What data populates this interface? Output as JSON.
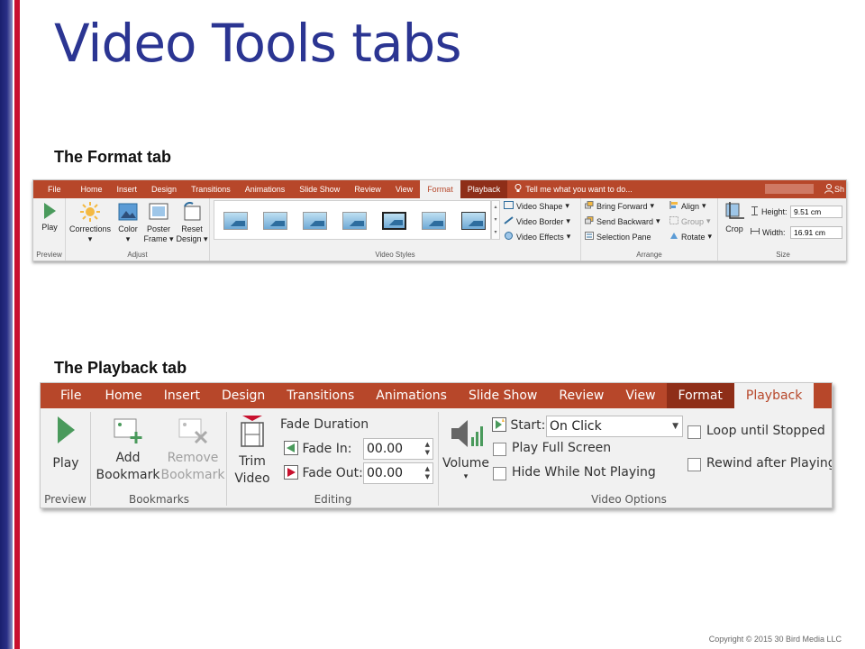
{
  "slide": {
    "title": "Video Tools tabs",
    "format_label": "The Format tab",
    "playback_label": "The Playback tab",
    "copyright": "Copyright © 2015 30 Bird Media LLC"
  },
  "format_ribbon": {
    "tabs": [
      "File",
      "Home",
      "Insert",
      "Design",
      "Transitions",
      "Animations",
      "Slide Show",
      "Review",
      "View",
      "Format",
      "Playback"
    ],
    "active_tab": "Format",
    "tell_me": "Tell me what you want to do...",
    "share": "Sh",
    "groups": {
      "preview": "Preview",
      "adjust": "Adjust",
      "video_styles": "Video Styles",
      "arrange": "Arrange",
      "size": "Size"
    },
    "buttons": {
      "play": "Play",
      "corrections": "Corrections",
      "color": "Color",
      "poster_frame_1": "Poster",
      "poster_frame_2": "Frame",
      "reset_design_1": "Reset",
      "reset_design_2": "Design",
      "video_shape": "Video Shape",
      "video_border": "Video Border",
      "video_effects": "Video Effects",
      "bring_forward": "Bring Forward",
      "send_backward": "Send Backward",
      "selection_pane": "Selection Pane",
      "align": "Align",
      "group": "Group",
      "rotate": "Rotate",
      "crop": "Crop",
      "height_label": "Height:",
      "width_label": "Width:"
    },
    "height_value": "9.51 cm",
    "width_value": "16.91 cm"
  },
  "playback_ribbon": {
    "tabs": [
      "File",
      "Home",
      "Insert",
      "Design",
      "Transitions",
      "Animations",
      "Slide Show",
      "Review",
      "View",
      "Format",
      "Playback"
    ],
    "active_tab": "Playback",
    "groups": {
      "preview": "Preview",
      "bookmarks": "Bookmarks",
      "editing": "Editing",
      "video_options": "Video Options"
    },
    "buttons": {
      "play": "Play",
      "add_bookmark_1": "Add",
      "add_bookmark_2": "Bookmark",
      "remove_bookmark_1": "Remove",
      "remove_bookmark_2": "Bookmark",
      "trim_video_1": "Trim",
      "trim_video_2": "Video",
      "volume": "Volume"
    },
    "fade_duration": "Fade Duration",
    "fade_in_label": "Fade In:",
    "fade_in_value": "00.00",
    "fade_out_label": "Fade Out:",
    "fade_out_value": "00.00",
    "start_label": "Start:",
    "start_value": "On Click",
    "play_full_screen": "Play Full Screen",
    "hide_while_not_playing": "Hide While Not Playing",
    "loop_until_stopped": "Loop until Stopped",
    "rewind_after_playing": "Rewind after Playing",
    "checkboxes": {
      "play_full_screen": false,
      "hide_while_not_playing": false,
      "loop_until_stopped": false,
      "rewind_after_playing": false
    }
  },
  "colors": {
    "title": "#2b3592",
    "ribbon_tab_bar": "#b7472a",
    "context_tab": "#8e2e18",
    "accent_red": "#c8102e",
    "play_green": "#4a9a5c"
  }
}
